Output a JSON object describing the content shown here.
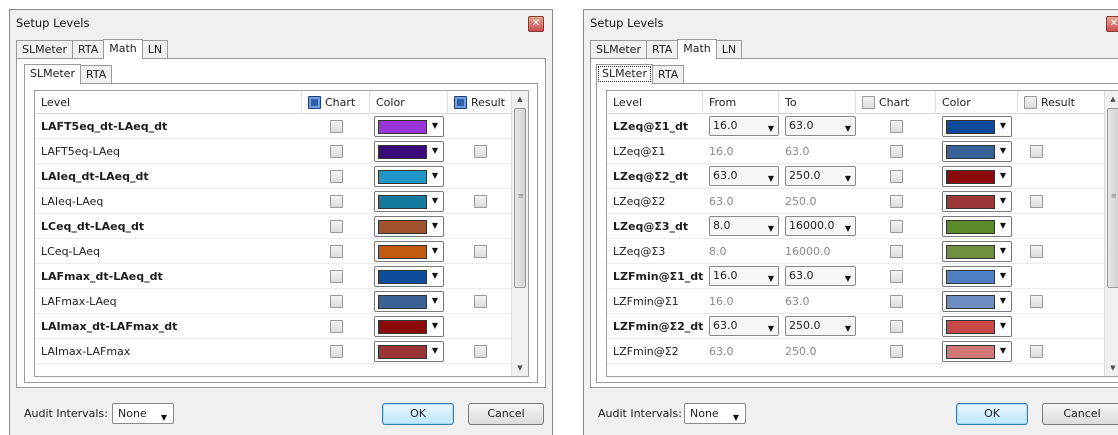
{
  "left": {
    "title": "Setup Levels",
    "tabs": [
      "SLMeter",
      "RTA",
      "Math",
      "LN"
    ],
    "inner_tabs": [
      "SLMeter",
      "RTA"
    ],
    "headers": {
      "level": "Level",
      "chart": "Chart",
      "color": "Color",
      "result": "Result"
    },
    "rows": [
      {
        "level": "LAFT5eq_dt-LAeq_dt",
        "bold": true,
        "color": "#9a35dc",
        "result": false
      },
      {
        "level": "LAFT5eq-LAeq",
        "bold": false,
        "color": "#3a0a7a",
        "result": true
      },
      {
        "level": "LAIeq_dt-LAeq_dt",
        "bold": true,
        "color": "#2196c9",
        "result": false
      },
      {
        "level": "LAIeq-LAeq",
        "bold": false,
        "color": "#147aa0",
        "result": true
      },
      {
        "level": "LCeq_dt-LAeq_dt",
        "bold": true,
        "color": "#a0522d",
        "result": false
      },
      {
        "level": "LCeq-LAeq",
        "bold": false,
        "color": "#c25a10",
        "result": true
      },
      {
        "level": "LAFmax_dt-LAeq_dt",
        "bold": true,
        "color": "#0d4e9c",
        "result": false
      },
      {
        "level": "LAFmax-LAeq",
        "bold": false,
        "color": "#3a6294",
        "result": true
      },
      {
        "level": "LAImax_dt-LAFmax_dt",
        "bold": true,
        "color": "#8b0a0a",
        "result": false
      },
      {
        "level": "LAImax-LAFmax",
        "bold": false,
        "color": "#9b3535",
        "result": true
      }
    ],
    "audit_label": "Audit Intervals:",
    "audit_value": "None",
    "ok": "OK",
    "cancel": "Cancel"
  },
  "right": {
    "title": "Setup Levels",
    "tabs": [
      "SLMeter",
      "RTA",
      "Math",
      "LN"
    ],
    "inner_tabs": [
      "SLMeter",
      "RTA"
    ],
    "headers": {
      "level": "Level",
      "from": "From",
      "to": "To",
      "chart": "Chart",
      "color": "Color",
      "result": "Result"
    },
    "rows": [
      {
        "level": "LZeq@Σ1_dt",
        "bold": true,
        "from": "16.0",
        "to": "63.0",
        "color": "#0d4a9c",
        "result": false
      },
      {
        "level": "LZeq@Σ1",
        "bold": false,
        "from": "16.0",
        "to": "63.0",
        "color": "#36639a",
        "result": true
      },
      {
        "level": "LZeq@Σ2_dt",
        "bold": true,
        "from": "63.0",
        "to": "250.0",
        "color": "#8b0a0a",
        "result": false
      },
      {
        "level": "LZeq@Σ2",
        "bold": false,
        "from": "63.0",
        "to": "250.0",
        "color": "#9b3838",
        "result": true
      },
      {
        "level": "LZeq@Σ3_dt",
        "bold": true,
        "from": "8.0",
        "to": "16000.0",
        "color": "#5a8a2a",
        "result": false
      },
      {
        "level": "LZeq@Σ3",
        "bold": false,
        "from": "8.0",
        "to": "16000.0",
        "color": "#6e9040",
        "result": true
      },
      {
        "level": "LZFmin@Σ1_dt",
        "bold": true,
        "from": "16.0",
        "to": "63.0",
        "color": "#4f80c4",
        "result": false
      },
      {
        "level": "LZFmin@Σ1",
        "bold": false,
        "from": "16.0",
        "to": "63.0",
        "color": "#6c8ec0",
        "result": true
      },
      {
        "level": "LZFmin@Σ2_dt",
        "bold": true,
        "from": "63.0",
        "to": "250.0",
        "color": "#c84848",
        "result": false
      },
      {
        "level": "LZFmin@Σ2",
        "bold": false,
        "from": "63.0",
        "to": "250.0",
        "color": "#d07878",
        "result": true
      }
    ],
    "audit_label": "Audit Intervals:",
    "audit_value": "None",
    "ok": "OK",
    "cancel": "Cancel"
  }
}
